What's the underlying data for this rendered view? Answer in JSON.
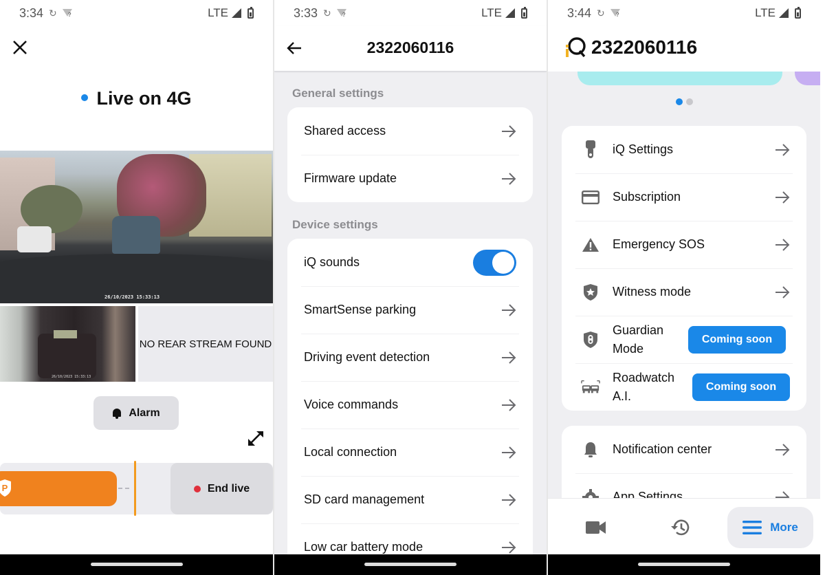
{
  "colors": {
    "accent_blue": "#1a88e8",
    "orange": "#f0821e",
    "live_red": "#e0303c",
    "section_gray": "#8c8c90"
  },
  "status_bars": [
    {
      "time": "3:34",
      "network": "LTE"
    },
    {
      "time": "3:33",
      "network": "LTE"
    },
    {
      "time": "3:44",
      "network": "LTE"
    }
  ],
  "live_view": {
    "close_icon": "close-icon",
    "title": "Live on 4G",
    "front_camera": {
      "timestamp": "26/10/2023 15:33:13"
    },
    "interior_camera": {
      "timestamp": "26/10/2023 15:33:13"
    },
    "rear_stream_message": "NO REAR STREAM FOUND",
    "alarm_label": "Alarm",
    "end_live_label": "End live"
  },
  "device_settings": {
    "header_title": "2322060116",
    "sections": [
      {
        "label": "General settings",
        "items": [
          {
            "label": "Shared access",
            "control": "arrow"
          },
          {
            "label": "Firmware update",
            "control": "arrow"
          }
        ]
      },
      {
        "label": "Device settings",
        "items": [
          {
            "label": "iQ sounds",
            "control": "toggle",
            "value": true
          },
          {
            "label": "SmartSense parking",
            "control": "arrow"
          },
          {
            "label": "Driving event detection",
            "control": "arrow"
          },
          {
            "label": "Voice commands",
            "control": "arrow"
          },
          {
            "label": "Local connection",
            "control": "arrow"
          },
          {
            "label": "SD card management",
            "control": "arrow"
          },
          {
            "label": "Low car battery mode",
            "control": "arrow"
          }
        ]
      }
    ]
  },
  "more_menu": {
    "header_title": "2322060116",
    "carousel": {
      "page_count": 2,
      "active_page": 1
    },
    "group1": [
      {
        "icon": "dashcam-icon",
        "label": "iQ Settings",
        "control": "arrow"
      },
      {
        "icon": "credit-card-icon",
        "label": "Subscription",
        "control": "arrow"
      },
      {
        "icon": "warning-icon",
        "label": "Emergency SOS",
        "control": "arrow"
      },
      {
        "icon": "shield-star-icon",
        "label": "Witness mode",
        "control": "arrow"
      },
      {
        "icon": "shield-traffic-light-icon",
        "label": "Guardian Mode",
        "control": "button",
        "button_label": "Coming soon"
      },
      {
        "icon": "cars-icon",
        "label": "Roadwatch A.I.",
        "control": "button",
        "button_label": "Coming soon"
      }
    ],
    "group2": [
      {
        "icon": "bell-icon",
        "label": "Notification center",
        "control": "arrow"
      },
      {
        "icon": "gear-icon",
        "label": "App Settings",
        "control": "arrow"
      }
    ],
    "bottom_nav": {
      "tabs": [
        {
          "icon": "video-camera-icon",
          "label": ""
        },
        {
          "icon": "history-icon",
          "label": ""
        },
        {
          "icon": "menu-icon",
          "label": "More",
          "active": true
        }
      ]
    }
  }
}
